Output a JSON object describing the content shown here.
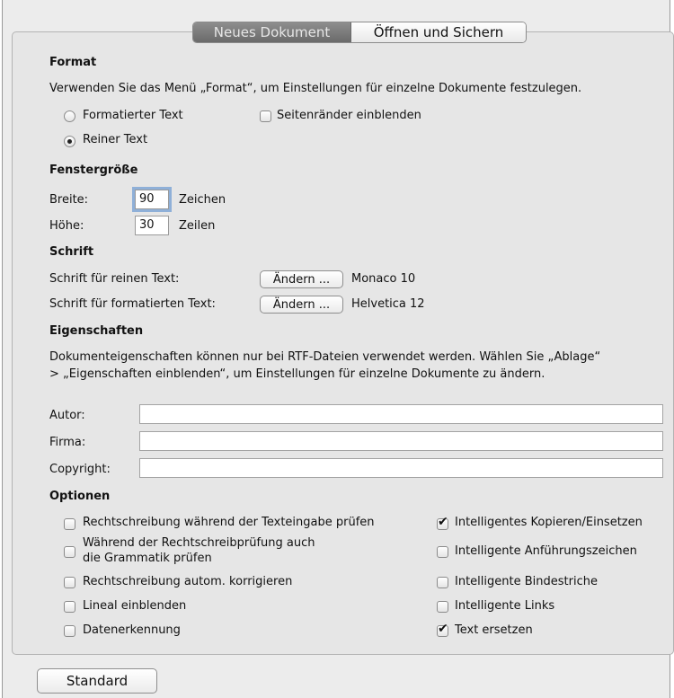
{
  "tabs": {
    "active": "Neues Dokument",
    "inactive": "Öffnen und Sichern"
  },
  "format": {
    "header": "Format",
    "description": "Verwenden Sie das Menü „Format“, um Einstellungen für einzelne Dokumente festzulegen.",
    "radio_formatted": "Formatierter Text",
    "radio_plain": "Reiner Text",
    "selected": "Reiner Text",
    "show_margins": "Seitenränder einblenden",
    "show_margins_checked": false
  },
  "window_size": {
    "header": "Fenstergröße",
    "width_label": "Breite:",
    "width_value": "90",
    "width_unit": "Zeichen",
    "height_label": "Höhe:",
    "height_value": "30",
    "height_unit": "Zeilen"
  },
  "font": {
    "header": "Schrift",
    "plain_label": "Schrift für reinen Text:",
    "plain_button": "Ändern ...",
    "plain_value": "Monaco 10",
    "rich_label": "Schrift für formatierten Text:",
    "rich_button": "Ändern ...",
    "rich_value": "Helvetica 12"
  },
  "properties": {
    "header": "Eigenschaften",
    "description_line1": "Dokumenteigenschaften können nur bei RTF-Dateien verwendet werden. Wählen Sie „Ablage“",
    "description_line2": "> „Eigenschaften einblenden“, um Einstellungen für einzelne Dokumente zu ändern.",
    "author_label": "Autor:",
    "author_value": "",
    "company_label": "Firma:",
    "company_value": "",
    "copyright_label": "Copyright:",
    "copyright_value": ""
  },
  "options": {
    "header": "Optionen",
    "left": [
      {
        "label": "Rechtschreibung während der Texteingabe prüfen",
        "checked": false
      },
      {
        "label_line1": "Während der Rechtschreibprüfung auch",
        "label_line2": "die Grammatik prüfen",
        "checked": false
      },
      {
        "label": "Rechtschreibung autom. korrigieren",
        "checked": false
      },
      {
        "label": "Lineal einblenden",
        "checked": false
      },
      {
        "label": "Datenerkennung",
        "checked": false
      }
    ],
    "right": [
      {
        "label": "Intelligentes Kopieren/Einsetzen",
        "checked": true
      },
      {
        "label": "Intelligente Anführungszeichen",
        "checked": false
      },
      {
        "label": "Intelligente Bindestriche",
        "checked": false
      },
      {
        "label": "Intelligente Links",
        "checked": false
      },
      {
        "label": "Text ersetzen",
        "checked": true
      }
    ]
  },
  "footer": {
    "default_button": "Standard"
  }
}
